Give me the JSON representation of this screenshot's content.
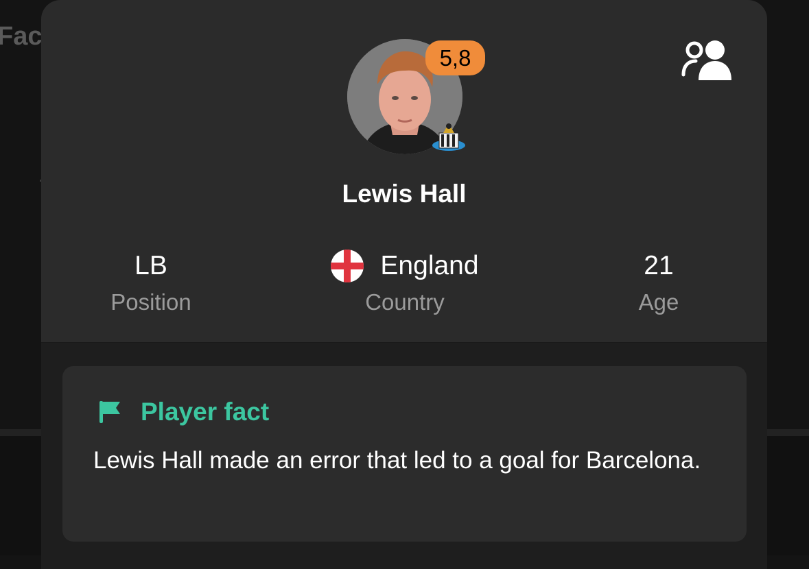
{
  "background": {
    "partial_heading": "Fact"
  },
  "player": {
    "name": "Lewis Hall",
    "rating": "5,8",
    "rating_color": "#f08c3a",
    "photo_icon": "player-photo",
    "club_icon": "newcastle-crest-icon"
  },
  "header": {
    "compare_icon": "compare-players-icon"
  },
  "stats": {
    "position": {
      "value": "LB",
      "label": "Position"
    },
    "country": {
      "value": "England",
      "label": "Country",
      "flag_icon": "england-flag-icon"
    },
    "age": {
      "value": "21",
      "label": "Age"
    }
  },
  "fact": {
    "title": "Player fact",
    "text": "Lewis Hall made an error that led to a goal for Barcelona.",
    "accent_color": "#3cc6a0",
    "icon": "flag-icon"
  }
}
